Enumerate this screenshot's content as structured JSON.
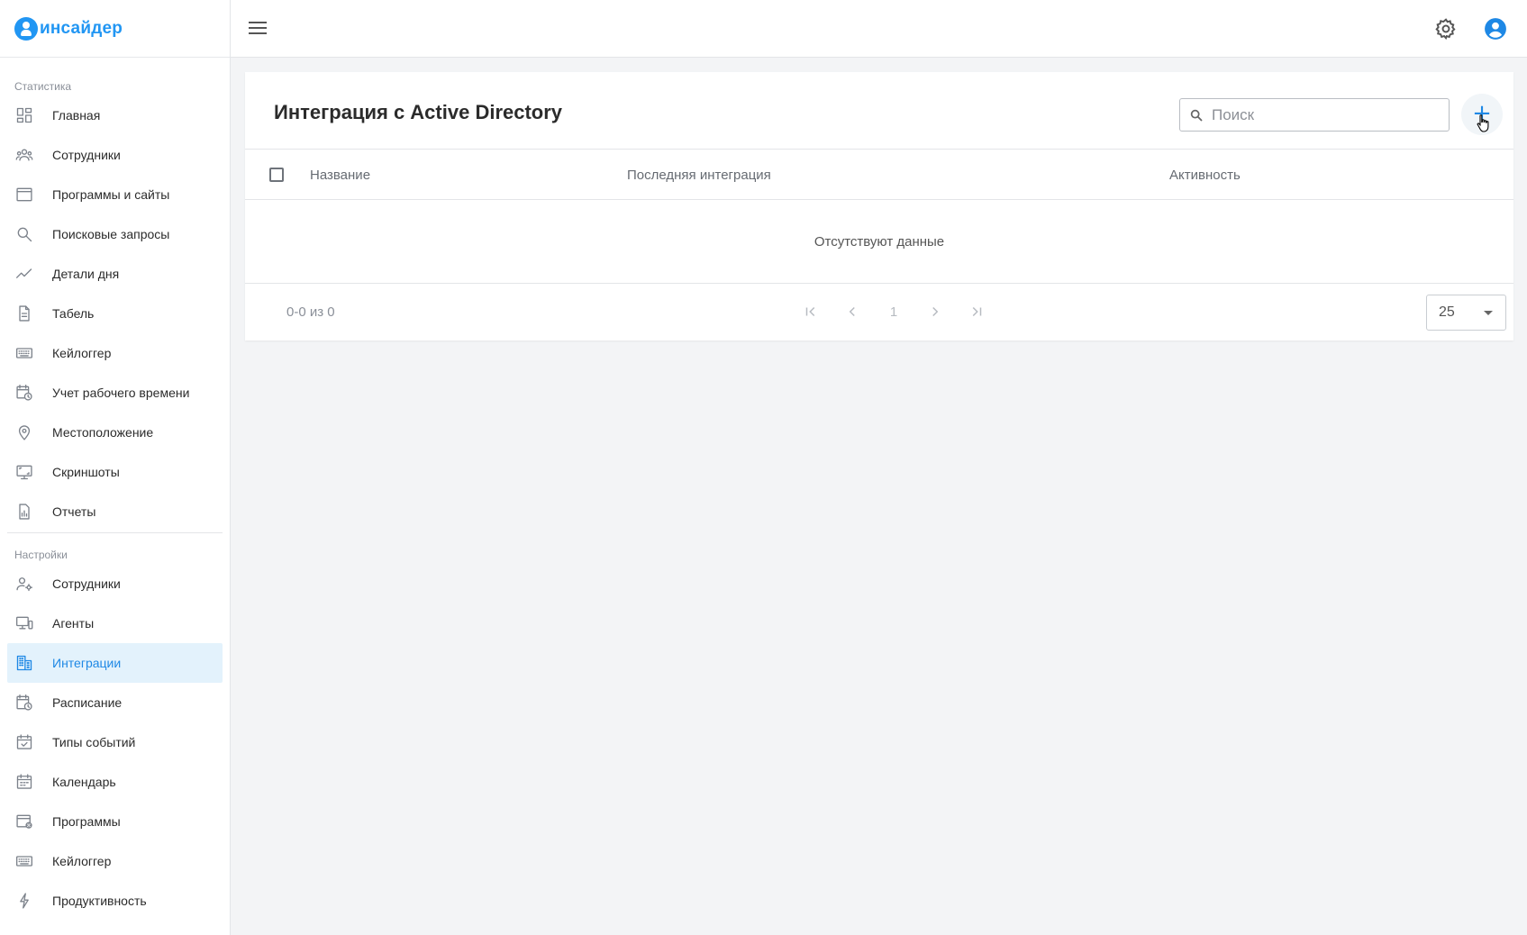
{
  "app": {
    "logo_text": "инсайдер",
    "brand_color": "#2196f3"
  },
  "sidebar": {
    "section_stats": "Статистика",
    "stats_items": [
      {
        "label": "Главная",
        "icon": "dashboard-icon"
      },
      {
        "label": "Сотрудники",
        "icon": "people-icon"
      },
      {
        "label": "Программы и сайты",
        "icon": "window-icon"
      },
      {
        "label": "Поисковые запросы",
        "icon": "search-icon"
      },
      {
        "label": "Детали дня",
        "icon": "trend-line-icon"
      },
      {
        "label": "Табель",
        "icon": "document-icon"
      },
      {
        "label": "Кейлоггер",
        "icon": "keyboard-icon"
      },
      {
        "label": "Учет рабочего времени",
        "icon": "clock-calendar-icon"
      },
      {
        "label": "Местоположение",
        "icon": "location-pin-icon"
      },
      {
        "label": "Скриншоты",
        "icon": "screenshot-icon"
      },
      {
        "label": "Отчеты",
        "icon": "report-icon"
      }
    ],
    "section_settings": "Настройки",
    "settings_items": [
      {
        "label": "Сотрудники",
        "icon": "user-settings-icon"
      },
      {
        "label": "Агенты",
        "icon": "devices-icon"
      },
      {
        "label": "Интеграции",
        "icon": "building-icon",
        "active": true
      },
      {
        "label": "Расписание",
        "icon": "schedule-icon"
      },
      {
        "label": "Типы событий",
        "icon": "event-check-icon"
      },
      {
        "label": "Календарь",
        "icon": "calendar-icon"
      },
      {
        "label": "Программы",
        "icon": "app-settings-icon"
      },
      {
        "label": "Кейлоггер",
        "icon": "keyboard-icon"
      },
      {
        "label": "Продуктивность",
        "icon": "bolt-icon"
      }
    ]
  },
  "main": {
    "title": "Интеграция с Active Directory",
    "search_placeholder": "Поиск",
    "add_label": "+",
    "table": {
      "columns": [
        "Название",
        "Последняя интеграция",
        "Активность"
      ],
      "empty_text": "Отсутствуют данные"
    },
    "pagination": {
      "range_text": "0-0 из 0",
      "current_page": "1",
      "per_page": "25"
    }
  }
}
